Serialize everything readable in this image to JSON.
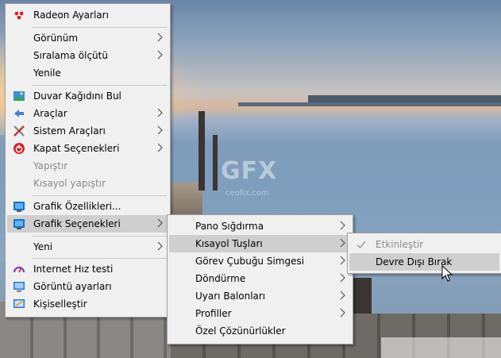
{
  "main_menu": {
    "items": [
      {
        "label": "Radeon Ayarları"
      },
      {
        "label": "Görünüm"
      },
      {
        "label": "Sıralama ölçütü"
      },
      {
        "label": "Yenile"
      },
      {
        "label": "Duvar Kağıdını Bul"
      },
      {
        "label": "Araçlar"
      },
      {
        "label": "Sistem Araçları"
      },
      {
        "label": "Kapat Seçenekleri"
      },
      {
        "label": "Yapıştır"
      },
      {
        "label": "Kısayol yapıştır"
      },
      {
        "label": "Grafik Özellikleri..."
      },
      {
        "label": "Grafik Seçenekleri"
      },
      {
        "label": "Yeni"
      },
      {
        "label": "Internet Hız testi"
      },
      {
        "label": "Görüntü ayarları"
      },
      {
        "label": "Kişiselleştir"
      }
    ]
  },
  "graphics_submenu": {
    "items": [
      {
        "label": "Pano Sığdırma"
      },
      {
        "label": "Kısayol Tuşları"
      },
      {
        "label": "Görev Çubuğu Simgesi"
      },
      {
        "label": "Döndürme"
      },
      {
        "label": "Uyarı Balonları"
      },
      {
        "label": "Profiller"
      },
      {
        "label": "Özel Çözünürlükler"
      }
    ]
  },
  "hotkeys_submenu": {
    "items": [
      {
        "label": "Etkinleştir",
        "checked": true
      },
      {
        "label": "Devre Dışı Bırak"
      }
    ]
  },
  "watermark": {
    "text": "GFX",
    "sub": "ceofix.com"
  }
}
